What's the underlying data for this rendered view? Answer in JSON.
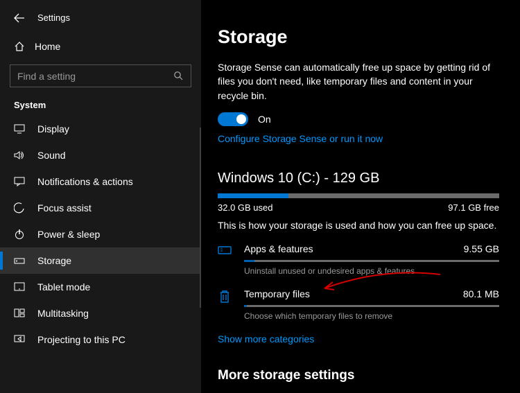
{
  "header": {
    "title": "Settings"
  },
  "search": {
    "placeholder": "Find a setting"
  },
  "home": {
    "label": "Home"
  },
  "section": "System",
  "nav": [
    {
      "label": "Display"
    },
    {
      "label": "Sound"
    },
    {
      "label": "Notifications & actions"
    },
    {
      "label": "Focus assist"
    },
    {
      "label": "Power & sleep"
    },
    {
      "label": "Storage"
    },
    {
      "label": "Tablet mode"
    },
    {
      "label": "Multitasking"
    },
    {
      "label": "Projecting to this PC"
    }
  ],
  "page": {
    "title": "Storage",
    "desc": "Storage Sense can automatically free up space by getting rid of files you don't need, like temporary files and content in your recycle bin.",
    "toggle_state": "On",
    "config_link": "Configure Storage Sense or run it now",
    "drive_title": "Windows 10 (C:) - 129 GB",
    "used": "32.0 GB used",
    "free": "97.1 GB free",
    "usage_desc": "This is how your storage is used and how you can free up space.",
    "cats": [
      {
        "name": "Apps & features",
        "size": "9.55 GB",
        "sub": "Uninstall unused or undesired apps & features"
      },
      {
        "name": "Temporary files",
        "size": "80.1 MB",
        "sub": "Choose which temporary files to remove"
      }
    ],
    "more_link": "Show more categories",
    "more_settings": "More storage settings"
  }
}
